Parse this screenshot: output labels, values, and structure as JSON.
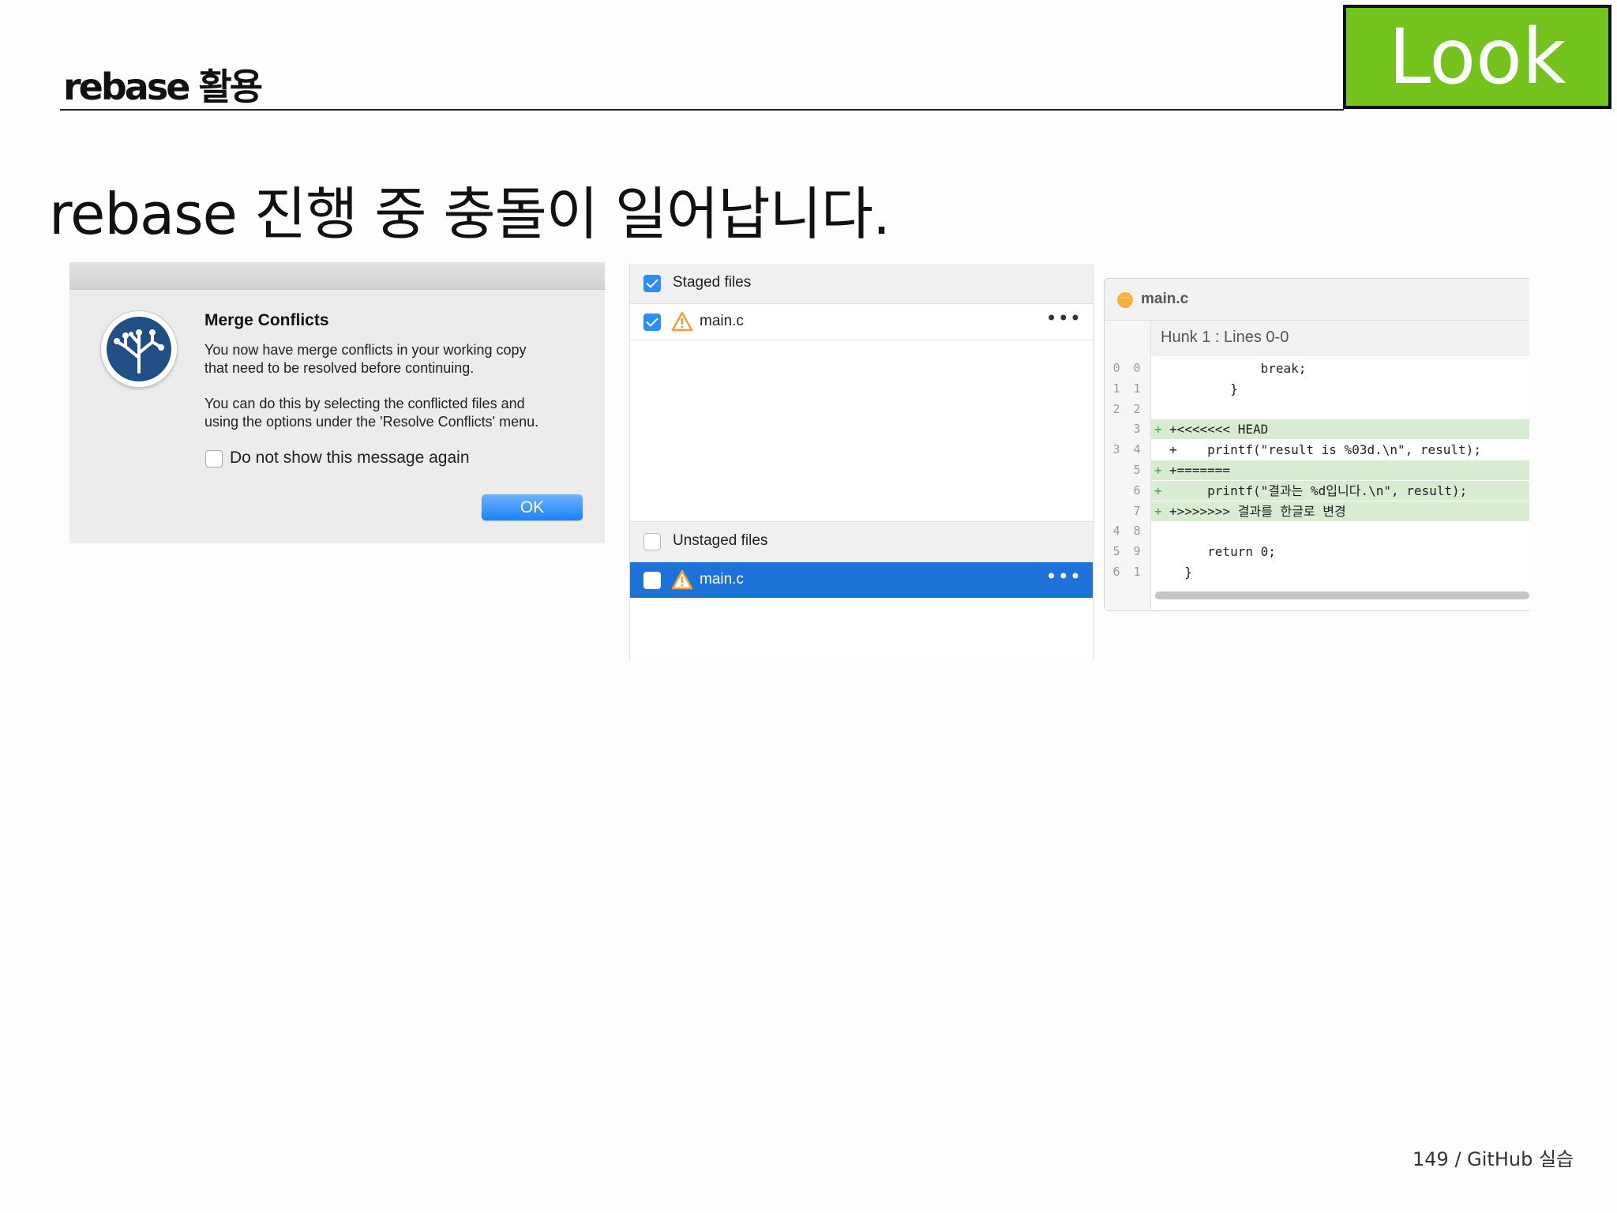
{
  "slide": {
    "title": "rebase 활용",
    "badge": "Look",
    "headline": "rebase 진행 중 충돌이 일어납니다.",
    "footer": "149 / GitHub 실습"
  },
  "dialog": {
    "title": "Merge Conflicts",
    "message1_line1": "You now have merge conflicts in your working copy",
    "message1_line2": "that need to be resolved before continuing.",
    "message2_line1": "You can do this by selecting the conflicted files and",
    "message2_line2": "using the options under the 'Resolve Conflicts' menu.",
    "checkbox_label": "Do not show this message again",
    "checkbox_checked": false,
    "ok_label": "OK"
  },
  "files": {
    "staged_label": "Staged files",
    "staged_checked": true,
    "staged_items": [
      {
        "name": "main.c",
        "checked": true,
        "warning": true
      }
    ],
    "unstaged_label": "Unstaged files",
    "unstaged_checked": false,
    "unstaged_items": [
      {
        "name": "main.c",
        "checked": false,
        "warning": true,
        "selected": true
      }
    ],
    "more_icon": "•••"
  },
  "diff": {
    "file": "main.c",
    "status_icon": "ellipsis-icon",
    "hunk_label": "Hunk 1 : Lines 0-0",
    "lines": [
      {
        "old": "0",
        "new": "0",
        "type": "ctx",
        "text": "            break;"
      },
      {
        "old": "1",
        "new": "1",
        "type": "ctx",
        "text": "        }"
      },
      {
        "old": "2",
        "new": "2",
        "type": "ctx",
        "text": ""
      },
      {
        "old": "",
        "new": "3",
        "type": "add",
        "text": "+<<<<<<< HEAD"
      },
      {
        "old": "3",
        "new": "4",
        "type": "ctx",
        "text": "+    printf(\"result is %03d.\\n\", result);"
      },
      {
        "old": "",
        "new": "5",
        "type": "add",
        "text": "+======="
      },
      {
        "old": "",
        "new": "6",
        "type": "add",
        "text": "     printf(\"결과는 %d입니다.\\n\", result);"
      },
      {
        "old": "",
        "new": "7",
        "type": "add",
        "text": "+>>>>>>> 결과를 한글로 변경"
      },
      {
        "old": "4",
        "new": "8",
        "type": "ctx",
        "text": ""
      },
      {
        "old": "5",
        "new": "9",
        "type": "ctx",
        "text": "     return 0;"
      },
      {
        "old": "6",
        "new": "1",
        "type": "ctx",
        "text": "  }"
      }
    ]
  },
  "colors": {
    "badge_green": "#74c21c",
    "accent_blue": "#1c72d8",
    "added_line": "#d8ecd2",
    "warning_orange": "#f29d38"
  }
}
